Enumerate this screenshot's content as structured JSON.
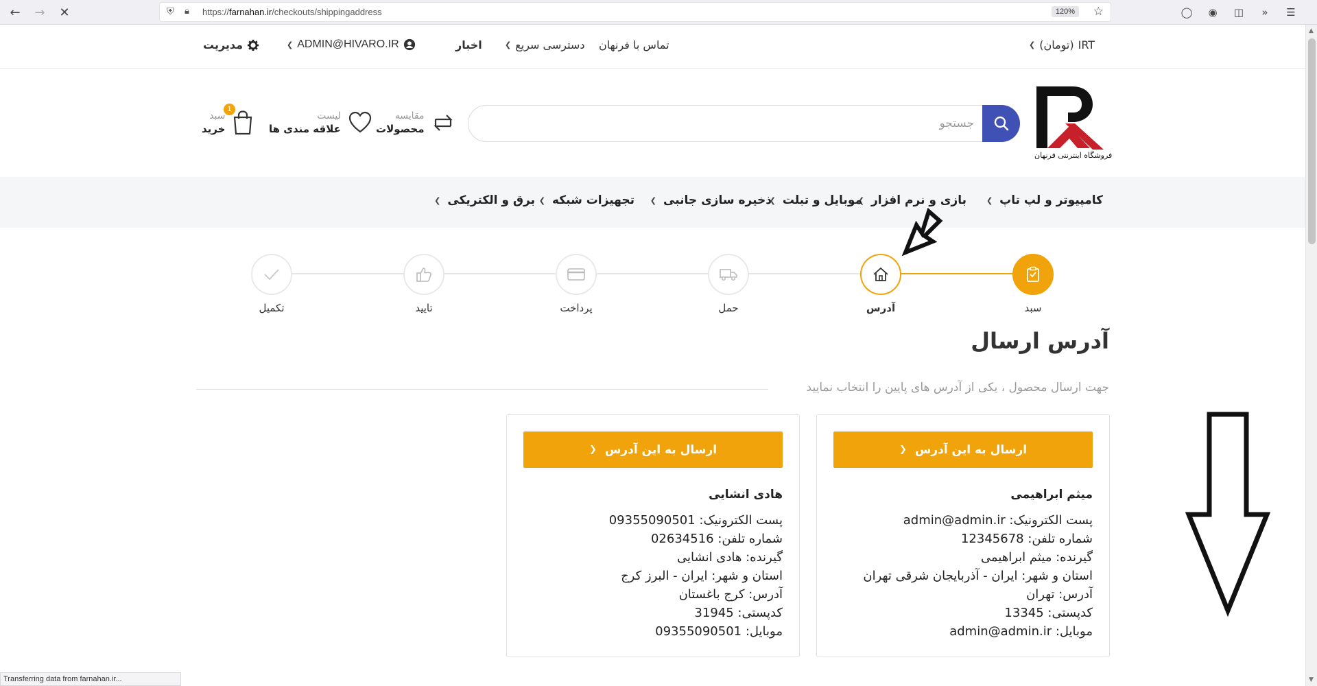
{
  "browser": {
    "url_prefix": "https://",
    "url_domain": "farnahan.ir",
    "url_path": "/checkouts/shippingaddress",
    "zoom": "120%",
    "status_text": "Transferring data from farnahan.ir..."
  },
  "topbar": {
    "currency": "IRT",
    "currency_label": "(تومان)",
    "contact": "تماس با فرنهان",
    "quick_access": "دسترسی سریع",
    "news": "اخبار",
    "user_email": "ADMIN@HIVARO.IR",
    "admin": "مدیریت"
  },
  "header": {
    "logo_caption": "فروشگاه اینترنتی فرنهان",
    "search_placeholder": "جستجو",
    "compare_small": "مقایسه",
    "compare_big": "محصولات",
    "wishlist_small": "لیست",
    "wishlist_big": "علاقه مندی ها",
    "cart_small": "سبد",
    "cart_big": "خرید",
    "cart_count": "1"
  },
  "categories": [
    "کامپیوتر و لپ تاپ",
    "بازی و نرم افزار",
    "موبایل و تبلت",
    "ذخیره سازی جانبی",
    "تجهیزات شبکه",
    "برق و الکتریکی"
  ],
  "steps": [
    {
      "label": "سبد",
      "state": "done",
      "icon": "clipboard-icon"
    },
    {
      "label": "آدرس",
      "state": "current",
      "icon": "home-icon"
    },
    {
      "label": "حمل",
      "state": "pending",
      "icon": "truck-icon"
    },
    {
      "label": "پرداخت",
      "state": "pending",
      "icon": "credit-card-icon"
    },
    {
      "label": "تایید",
      "state": "pending",
      "icon": "thumbs-up-icon"
    },
    {
      "label": "تکمیل",
      "state": "pending",
      "icon": "check-icon"
    }
  ],
  "page": {
    "title": "آدرس ارسال",
    "subtitle": "جهت ارسال محصول ، یکی از آدرس های پایین را انتخاب نمایید"
  },
  "addresses": [
    {
      "button": "ارسال به این آدرس",
      "name": "میثم ابراهیمی",
      "email": "پست الکترونیک: admin@admin.ir",
      "phone": "شماره تلفن: 12345678",
      "receiver": "گیرنده: میثم ابراهیمی",
      "province_city": "استان و شهر: ایران - آذربایجان شرقی تهران",
      "address": "آدرس: تهران",
      "postal": "کدپستی: 13345",
      "mobile": "موبایل: admin@admin.ir"
    },
    {
      "button": "ارسال به این آدرس",
      "name": "هادی انشایی",
      "email": "پست الکترونیک: 09355090501",
      "phone": "شماره تلفن: 02634516",
      "receiver": "گیرنده: هادی انشایی",
      "province_city": "استان و شهر: ایران - البرز کرج",
      "address": "آدرس: کرج باغستان",
      "postal": "کدپستی: 31945",
      "mobile": "موبایل: 09355090501"
    }
  ],
  "colors": {
    "accent": "#f0a30a",
    "search_button": "#3f51b5",
    "nav_bg": "#f5f6f8",
    "logo_red": "#c8202a"
  }
}
